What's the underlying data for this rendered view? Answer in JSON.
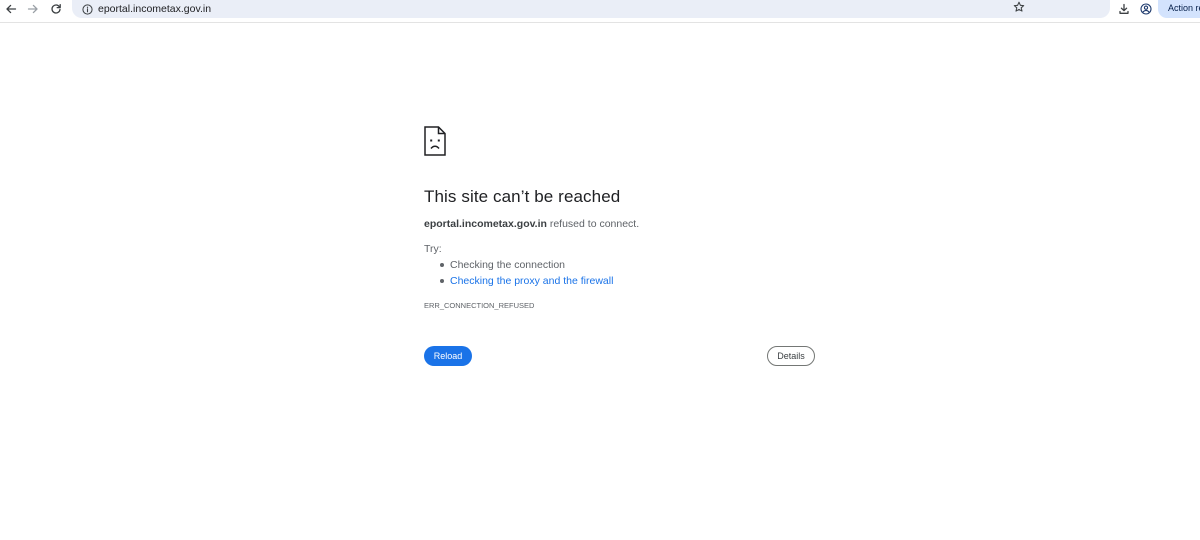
{
  "toolbar": {
    "back_icon": "arrow-left-icon",
    "forward_icon": "arrow-right-icon",
    "reload_icon": "reload-icon",
    "site_info_icon": "info-icon",
    "url": "eportal.incometax.gov.in",
    "bookmark_icon": "star-icon",
    "download_icon": "download-icon",
    "profile_icon": "profile-icon",
    "action_label": "Action re"
  },
  "error_page": {
    "icon": "sad-page-icon",
    "title": "This site can’t be reached",
    "host": "eportal.incometax.gov.in",
    "summary_suffix": " refused to connect.",
    "try_label": "Try:",
    "suggestions": [
      "Checking the connection",
      "Checking the proxy and the firewall"
    ],
    "error_code": "ERR_CONNECTION_REFUSED",
    "reload_label": "Reload",
    "details_label": "Details"
  },
  "colors": {
    "omnibox_bg": "#eaeef7",
    "link": "#1a73e8",
    "primary_button": "#1a73e8",
    "action_pill": "#d3e3fd"
  }
}
